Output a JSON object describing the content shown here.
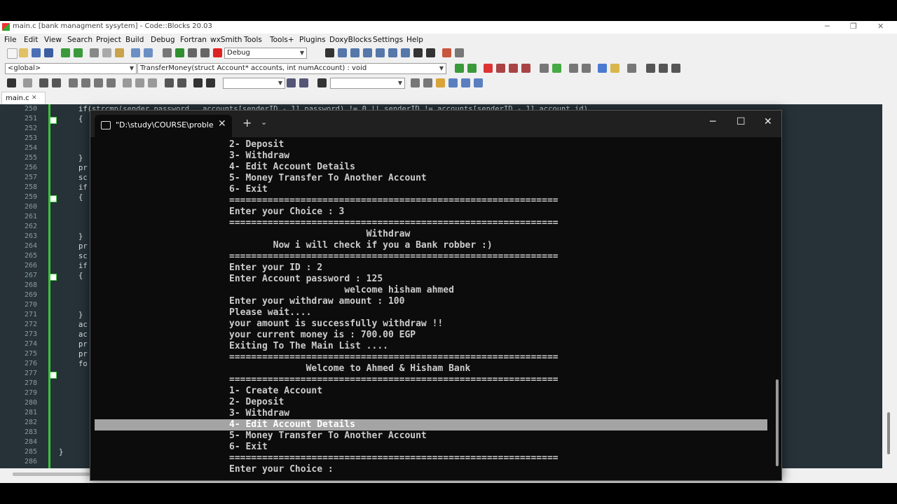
{
  "window": {
    "title": "main.c [bank managment sysytem] - Code::Blocks 20.03"
  },
  "menu": [
    "File",
    "Edit",
    "View",
    "Search",
    "Project",
    "Build",
    "Debug",
    "Fortran",
    "wxSmith",
    "Tools",
    "Tools+",
    "Plugins",
    "DoxyBlocks",
    "Settings",
    "Help"
  ],
  "toolbar": {
    "build_target": "Debug",
    "scope": "<global>",
    "function": "TransferMoney(struct Account* accounts, int numAccount) : void"
  },
  "editor": {
    "file_tab": "main.c",
    "line_numbers": [
      "250",
      "251",
      "252",
      "253",
      "254",
      "255",
      "256",
      "257",
      "258",
      "259",
      "260",
      "261",
      "262",
      "263",
      "264",
      "265",
      "266",
      "267",
      "268",
      "269",
      "270",
      "271",
      "272",
      "273",
      "274",
      "275",
      "276",
      "277",
      "278",
      "279",
      "280",
      "281",
      "282",
      "283",
      "284",
      "285",
      "286"
    ],
    "code_top": "if(strcmp(sender_password , accounts[senderID - 1].password) != 0 || senderID != accounts[senderID - 1].account_id)",
    "code_lines": [
      {
        "ln": "251",
        "text": "{"
      },
      {
        "ln": "255",
        "text": "}"
      },
      {
        "ln": "256",
        "text": "pr"
      },
      {
        "ln": "257",
        "text": "sc"
      },
      {
        "ln": "258",
        "text": "if"
      },
      {
        "ln": "259",
        "text": "{"
      },
      {
        "ln": "263",
        "text": "}"
      },
      {
        "ln": "264",
        "text": "pr"
      },
      {
        "ln": "265",
        "text": "sc"
      },
      {
        "ln": "266",
        "text": "if"
      },
      {
        "ln": "267",
        "text": "{"
      },
      {
        "ln": "271",
        "text": "}"
      },
      {
        "ln": "272",
        "text": "ac"
      },
      {
        "ln": "273",
        "text": "ac"
      },
      {
        "ln": "274",
        "text": "pr"
      },
      {
        "ln": "275",
        "text": "pr"
      },
      {
        "ln": "276",
        "text": "fo"
      },
      {
        "ln": "285",
        "text": "}"
      }
    ]
  },
  "terminal": {
    "tab_title": "\"D:\\study\\COURSE\\problem s",
    "lines": [
      "2- Deposit",
      "3- Withdraw",
      "4- Edit Account Details",
      "5- Money Transfer To Another Account",
      "6- Exit",
      "============================================================",
      "Enter your Choice : 3",
      "============================================================",
      "                         Withdraw",
      "        Now i will check if you a Bank robber :)",
      "============================================================",
      "Enter your ID : 2",
      "Enter Account password : 125",
      "                     welcome hisham ahmed",
      "Enter your withdraw amount : 100",
      "Please wait....",
      "your amount is successfully withdraw !!",
      "your current money is : 700.00 EGP",
      "Exiting To The Main List ....",
      "============================================================",
      "              Welcome to Ahmed & Hisham Bank",
      "============================================================",
      "1- Create Account",
      "2- Deposit",
      "3- Withdraw",
      "4- Edit Account Details",
      "5- Money Transfer To Another Account",
      "6- Exit",
      "============================================================",
      "Enter your Choice :"
    ],
    "selected_line": 25
  }
}
